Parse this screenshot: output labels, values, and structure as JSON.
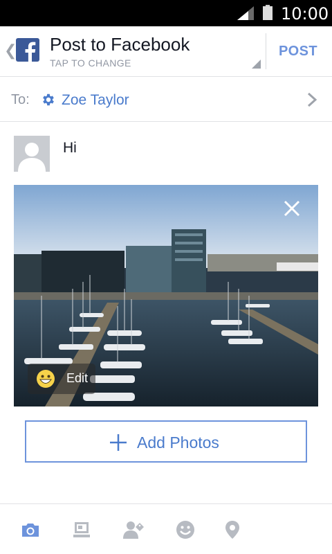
{
  "status_bar": {
    "time": "10:00"
  },
  "header": {
    "title": "Post to Facebook",
    "subtitle": "TAP TO CHANGE",
    "post_label": "POST"
  },
  "audience": {
    "to_label": "To:",
    "recipient": "Zoe Taylor"
  },
  "composer": {
    "text": "Hi"
  },
  "photo": {
    "edit_label": "Edit"
  },
  "add_photos": {
    "label": "Add Photos"
  },
  "bottom_bar": {
    "icons": [
      "camera-icon",
      "album-icon",
      "tag-people-icon",
      "feeling-icon",
      "location-icon"
    ]
  },
  "colors": {
    "accent": "#4a7bcc",
    "post_button": "#6d93dc",
    "facebook_blue": "#3b5998",
    "icon_gray": "#b7bbc2"
  }
}
